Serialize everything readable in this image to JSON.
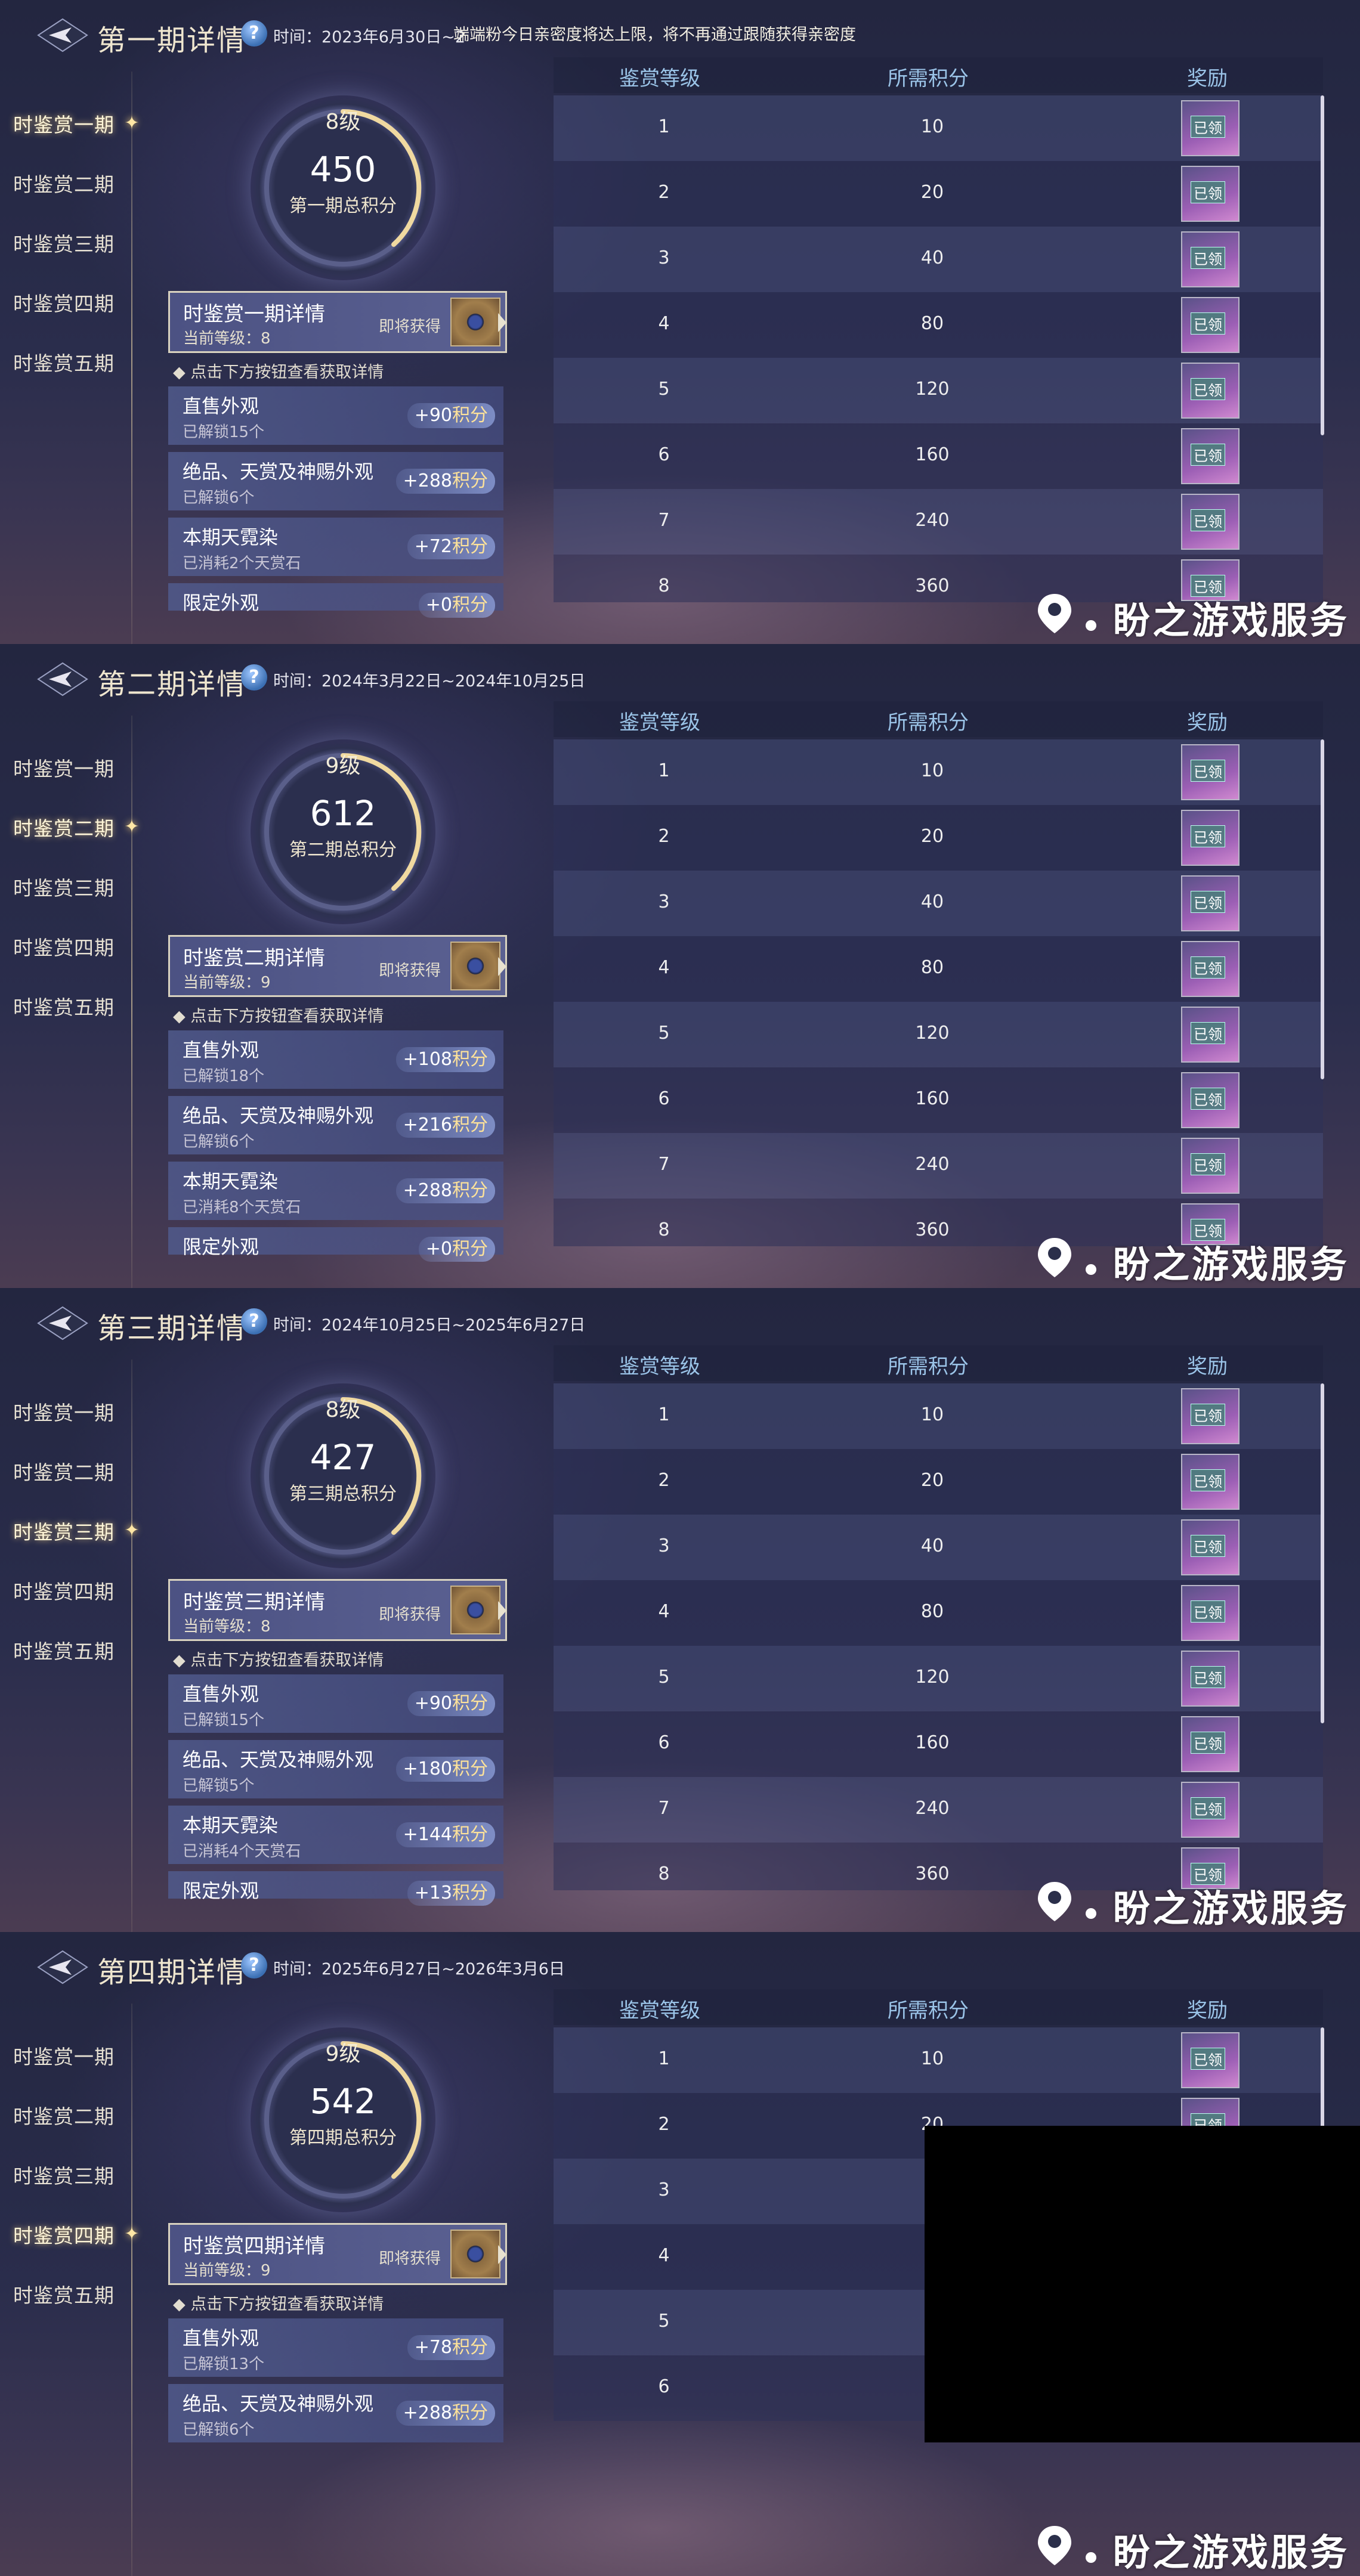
{
  "panels": [
    {
      "title": "第一期详情",
      "period": "时间：2023年6月30日~2",
      "notice": "端端粉今日亲密度将达上限，将不再通过跟随获得亲密度",
      "active_index": 0,
      "level": "8级",
      "score": "450",
      "score_label": "第一期总积分",
      "detail_title": "时鉴赏一期详情",
      "detail_level": "当前等级：8",
      "detail_soon": "即将获得",
      "sources": [
        {
          "name": "直售外观",
          "sub": "已解锁15个",
          "pts": "+90",
          "unit": "积分"
        },
        {
          "name": "绝品、天赏及神赐外观",
          "sub": "已解锁6个",
          "pts": "+288",
          "unit": "积分"
        },
        {
          "name": "本期天霓染",
          "sub": "已消耗2个天赏石",
          "pts": "+72",
          "unit": "积分"
        },
        {
          "name": "限定外观",
          "sub": "",
          "pts": "+0",
          "unit": "积分"
        }
      ]
    },
    {
      "title": "第二期详情",
      "period": "时间：2024年3月22日~2024年10月25日",
      "notice": "",
      "active_index": 1,
      "level": "9级",
      "score": "612",
      "score_label": "第二期总积分",
      "detail_title": "时鉴赏二期详情",
      "detail_level": "当前等级：9",
      "detail_soon": "即将获得",
      "sources": [
        {
          "name": "直售外观",
          "sub": "已解锁18个",
          "pts": "+108",
          "unit": "积分"
        },
        {
          "name": "绝品、天赏及神赐外观",
          "sub": "已解锁6个",
          "pts": "+216",
          "unit": "积分"
        },
        {
          "name": "本期天霓染",
          "sub": "已消耗8个天赏石",
          "pts": "+288",
          "unit": "积分"
        },
        {
          "name": "限定外观",
          "sub": "",
          "pts": "+0",
          "unit": "积分"
        }
      ]
    },
    {
      "title": "第三期详情",
      "period": "时间：2024年10月25日~2025年6月27日",
      "notice": "",
      "active_index": 2,
      "level": "8级",
      "score": "427",
      "score_label": "第三期总积分",
      "detail_title": "时鉴赏三期详情",
      "detail_level": "当前等级：8",
      "detail_soon": "即将获得",
      "sources": [
        {
          "name": "直售外观",
          "sub": "已解锁15个",
          "pts": "+90",
          "unit": "积分"
        },
        {
          "name": "绝品、天赏及神赐外观",
          "sub": "已解锁5个",
          "pts": "+180",
          "unit": "积分"
        },
        {
          "name": "本期天霓染",
          "sub": "已消耗4个天赏石",
          "pts": "+144",
          "unit": "积分"
        },
        {
          "name": "限定外观",
          "sub": "",
          "pts": "+13",
          "unit": "积分"
        }
      ]
    },
    {
      "title": "第四期详情",
      "period": "时间：2025年6月27日~2026年3月6日",
      "notice": "",
      "active_index": 3,
      "level": "9级",
      "score": "542",
      "score_label": "第四期总积分",
      "detail_title": "时鉴赏四期详情",
      "detail_level": "当前等级：9",
      "detail_soon": "即将获得",
      "sources": [
        {
          "name": "直售外观",
          "sub": "已解锁13个",
          "pts": "+78",
          "unit": "积分"
        },
        {
          "name": "绝品、天赏及神赐外观",
          "sub": "已解锁6个",
          "pts": "+288",
          "unit": "积分"
        }
      ]
    }
  ],
  "sidebar": [
    "时鉴赏一期",
    "时鉴赏二期",
    "时鉴赏三期",
    "时鉴赏四期",
    "时鉴赏五期"
  ],
  "hint": "点击下方按钮查看获取详情",
  "table_headers": {
    "level": "鉴赏等级",
    "points": "所需积分",
    "reward": "奖励"
  },
  "tiers": [
    {
      "level": "1",
      "points": "10"
    },
    {
      "level": "2",
      "points": "20"
    },
    {
      "level": "3",
      "points": "40"
    },
    {
      "level": "4",
      "points": "80"
    },
    {
      "level": "5",
      "points": "120"
    },
    {
      "level": "6",
      "points": "160"
    },
    {
      "level": "7",
      "points": "240"
    },
    {
      "level": "8",
      "points": "360"
    }
  ],
  "panel4_tiers": [
    {
      "level": "1",
      "points": "10"
    },
    {
      "level": "2",
      "points": "20"
    },
    {
      "level": "3",
      "points": ""
    },
    {
      "level": "4",
      "points": ""
    },
    {
      "level": "5",
      "points": ""
    },
    {
      "level": "6",
      "points": ""
    }
  ],
  "reward_status": "已领",
  "watermark": "盼之游戏服务",
  "colors": {
    "accent": "#9bc4e8",
    "gold": "#ffe39a",
    "bg": "#262a46"
  }
}
